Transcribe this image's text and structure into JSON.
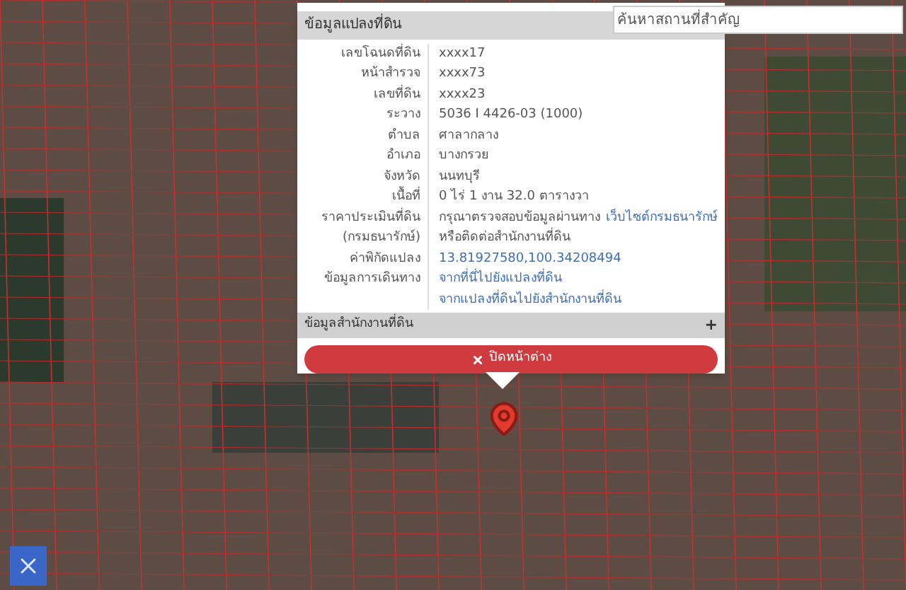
{
  "search": {
    "placeholder": "ค้นหาสถานที่สำคัญ"
  },
  "popup": {
    "title": "ข้อมูลแปลงที่ดิน",
    "rows": [
      {
        "label": [
          "เลขโฉนดที่ดิน"
        ],
        "lines": [
          [
            {
              "kind": "text",
              "text": "xxxx17"
            }
          ]
        ]
      },
      {
        "label": [
          "หน้าสำรวจ"
        ],
        "lines": [
          [
            {
              "kind": "text",
              "text": "xxxx73"
            }
          ]
        ]
      },
      {
        "label": [
          "เลขที่ดิน"
        ],
        "lines": [
          [
            {
              "kind": "text",
              "text": "xxxx23"
            }
          ]
        ]
      },
      {
        "label": [
          "ระวาง"
        ],
        "lines": [
          [
            {
              "kind": "text",
              "text": "5036 I 4426-03 (1000)"
            }
          ]
        ]
      },
      {
        "label": [
          "ตำบล"
        ],
        "lines": [
          [
            {
              "kind": "text",
              "text": "ศาลากลาง"
            }
          ]
        ]
      },
      {
        "label": [
          "อำเภอ"
        ],
        "lines": [
          [
            {
              "kind": "text",
              "text": "บางกรวย"
            }
          ]
        ]
      },
      {
        "label": [
          "จังหวัด"
        ],
        "lines": [
          [
            {
              "kind": "text",
              "text": "นนทบุรี"
            }
          ]
        ]
      },
      {
        "label": [
          "เนื้อที่"
        ],
        "lines": [
          [
            {
              "kind": "text",
              "text": "0 ไร่ 1 งาน 32.0 ตารางวา"
            }
          ]
        ]
      },
      {
        "label": [
          "ราคาประเมินที่ดิน",
          "(กรมธนารักษ์)"
        ],
        "lines": [
          [
            {
              "kind": "text",
              "text": "กรุณาตรวจสอบข้อมูลผ่านทาง"
            },
            {
              "kind": "link",
              "text": "เว็บไซต์กรมธนารักษ์"
            }
          ],
          [
            {
              "kind": "text",
              "text": "หรือติดต่อสำนักงานที่ดิน"
            }
          ]
        ]
      },
      {
        "label": [
          "ค่าพิกัดแปลง"
        ],
        "lines": [
          [
            {
              "kind": "link",
              "text": "13.81927580,100.34208494"
            }
          ]
        ]
      },
      {
        "label": [
          "ข้อมูลการเดินทาง"
        ],
        "lines": [
          [
            {
              "kind": "link",
              "text": "จากที่นี่ไปยังแปลงที่ดิน"
            }
          ],
          [
            {
              "kind": "link",
              "text": "จากแปลงที่ดินไปยังสำนักงานที่ดิน"
            }
          ]
        ]
      }
    ],
    "section": {
      "title": "ข้อมูลสำนักงานที่ดิน",
      "expanded": false,
      "toggle": "+"
    },
    "close_button": "ปิดหน้าต่าง"
  }
}
